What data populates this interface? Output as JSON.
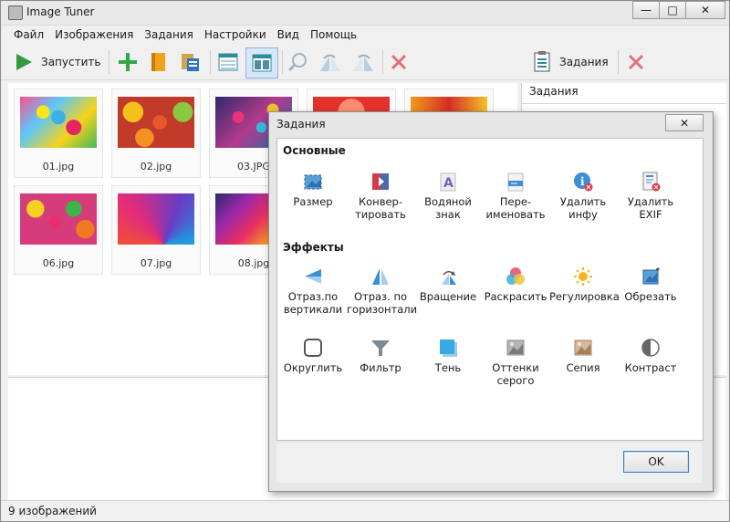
{
  "window": {
    "title": "Image Tuner",
    "minimize": "—",
    "maximize": "□",
    "close": "✕"
  },
  "menu": [
    "Файл",
    "Изображения",
    "Задания",
    "Настройки",
    "Вид",
    "Помощь"
  ],
  "toolbar": {
    "run_label": "Запустить",
    "tasks_label": "Задания"
  },
  "right_panel": {
    "header": "Задания"
  },
  "thumbnails": [
    {
      "name": "01.jpg"
    },
    {
      "name": "02.jpg"
    },
    {
      "name": "03.JPG"
    },
    {
      "name": "06.jpg"
    },
    {
      "name": "07.jpg"
    },
    {
      "name": "08.jpg"
    }
  ],
  "status": {
    "text": "9 изображений"
  },
  "dialog": {
    "title": "Задания",
    "close": "✕",
    "section_basic": "Основные",
    "section_effects": "Эффекты",
    "basic": [
      {
        "l1": "Размер",
        "l2": ""
      },
      {
        "l1": "Конвер-",
        "l2": "тировать"
      },
      {
        "l1": "Водяной",
        "l2": "знак"
      },
      {
        "l1": "Пере-",
        "l2": "именовать"
      },
      {
        "l1": "Удалить",
        "l2": "инфу"
      },
      {
        "l1": "Удалить",
        "l2": "EXIF"
      }
    ],
    "effects1": [
      {
        "l1": "Отраз.по",
        "l2": "вертикали"
      },
      {
        "l1": "Отраз. по",
        "l2": "горизонтали"
      },
      {
        "l1": "Вращение",
        "l2": ""
      },
      {
        "l1": "Раскрасить",
        "l2": ""
      },
      {
        "l1": "Регулировка",
        "l2": ""
      },
      {
        "l1": "Обрезать",
        "l2": ""
      }
    ],
    "effects2": [
      {
        "l1": "Округлить",
        "l2": ""
      },
      {
        "l1": "Фильтр",
        "l2": ""
      },
      {
        "l1": "Тень",
        "l2": ""
      },
      {
        "l1": "Оттенки",
        "l2": "серого"
      },
      {
        "l1": "Сепия",
        "l2": ""
      },
      {
        "l1": "Контраст",
        "l2": ""
      }
    ],
    "ok_label": "OK"
  }
}
